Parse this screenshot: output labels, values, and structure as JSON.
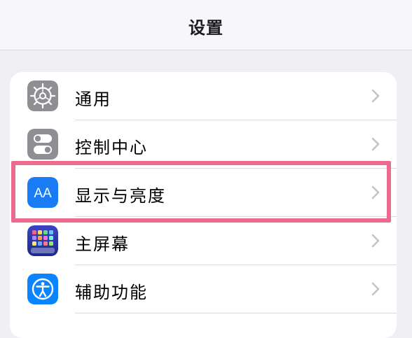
{
  "header": {
    "title": "设置"
  },
  "settings": {
    "items": [
      {
        "label": "通用",
        "icon": "gear-icon"
      },
      {
        "label": "控制中心",
        "icon": "toggles-icon"
      },
      {
        "label": "显示与亮度",
        "icon": "text-size-icon",
        "icon_text": "AA"
      },
      {
        "label": "主屏幕",
        "icon": "home-screen-icon"
      },
      {
        "label": "辅助功能",
        "icon": "accessibility-icon"
      }
    ]
  },
  "colors": {
    "highlight": "#ec6a8e",
    "display_icon_bg": "#1a7cf4",
    "gear_icon_bg": "#8e8e93",
    "accessibility_icon_bg": "#0a84ff"
  }
}
